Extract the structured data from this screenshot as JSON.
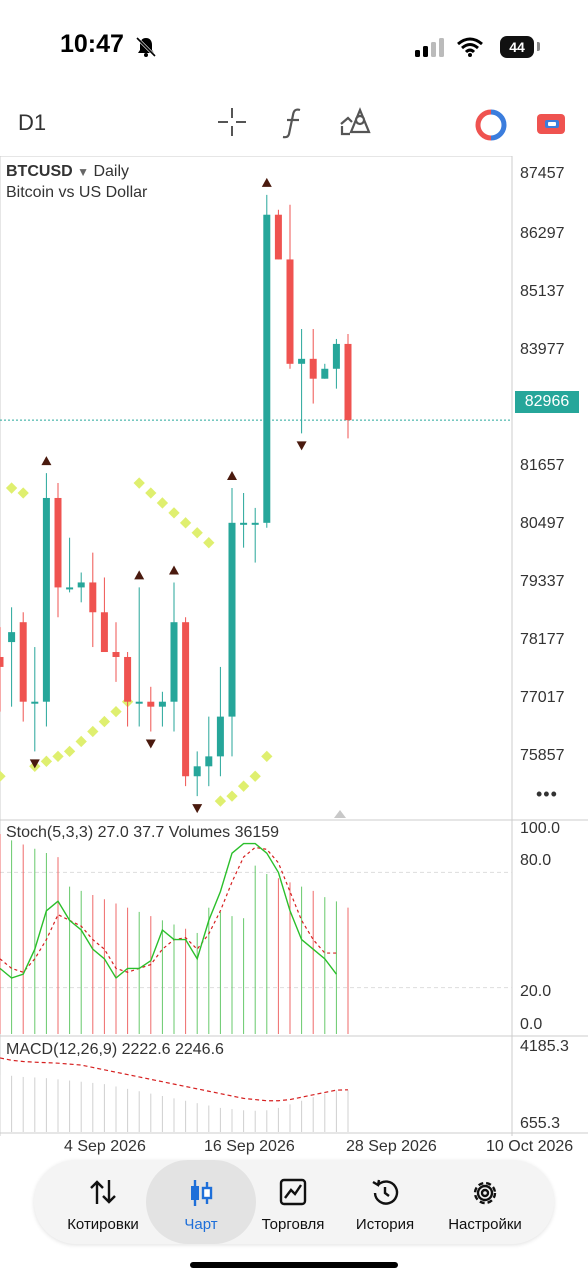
{
  "status": {
    "time": "10:47",
    "battery": "44"
  },
  "toolbar": {
    "timeframe": "D1",
    "icons": [
      "crosshair-icon",
      "function-icon",
      "objects-icon",
      "one-click-trading-icon",
      "account-icon"
    ]
  },
  "chart": {
    "symbol": "BTCUSD",
    "period": "Daily",
    "description": "Bitcoin vs US Dollar",
    "current_price": "82966",
    "price_axis": [
      "87457",
      "86297",
      "85137",
      "83977",
      "81657",
      "80497",
      "79337",
      "78177",
      "77017",
      "75857"
    ],
    "stoch_label": "Stoch(5,3,3) 27.0 37.7 Volumes 36159",
    "stoch_axis": [
      "100.0",
      "80.0",
      "20.0",
      "0.0"
    ],
    "macd_label": "MACD(12,26,9) 2222.6 2246.6",
    "macd_axis": [
      "4185.3",
      "655.3"
    ],
    "date_axis": [
      "4 Sep 2026",
      "16 Sep 2026",
      "28 Sep 2026",
      "10 Oct 2026"
    ],
    "colors": {
      "bull": "#26a69a",
      "bear": "#ef5350",
      "sar": "#dfef6f",
      "fractal": "#4a1a0e",
      "stoch_main": "#2bbf2b",
      "stoch_signal": "#d62020"
    }
  },
  "chart_data": {
    "type": "candlestick",
    "price_range": [
      75000,
      88000
    ],
    "candles": [
      {
        "o": 78200,
        "h": 78800,
        "l": 77100,
        "c": 78000
      },
      {
        "o": 78500,
        "h": 79200,
        "l": 77200,
        "c": 78700
      },
      {
        "o": 78900,
        "h": 79100,
        "l": 76900,
        "c": 77300
      },
      {
        "o": 77300,
        "h": 78400,
        "l": 76300,
        "c": 77300
      },
      {
        "o": 77300,
        "h": 81900,
        "l": 76800,
        "c": 81400
      },
      {
        "o": 81400,
        "h": 81700,
        "l": 79000,
        "c": 79600
      },
      {
        "o": 79600,
        "h": 80600,
        "l": 79500,
        "c": 79600
      },
      {
        "o": 79600,
        "h": 79900,
        "l": 79300,
        "c": 79700
      },
      {
        "o": 79700,
        "h": 80300,
        "l": 78400,
        "c": 79100
      },
      {
        "o": 79100,
        "h": 79800,
        "l": 78500,
        "c": 78300
      },
      {
        "o": 78300,
        "h": 78900,
        "l": 77700,
        "c": 78200
      },
      {
        "o": 78200,
        "h": 78300,
        "l": 76800,
        "c": 77300
      },
      {
        "o": 77300,
        "h": 79600,
        "l": 76800,
        "c": 77300
      },
      {
        "o": 77300,
        "h": 77600,
        "l": 76700,
        "c": 77200
      },
      {
        "o": 77200,
        "h": 77500,
        "l": 76800,
        "c": 77300
      },
      {
        "o": 77300,
        "h": 79700,
        "l": 76700,
        "c": 78900
      },
      {
        "o": 78900,
        "h": 79000,
        "l": 75600,
        "c": 75800
      },
      {
        "o": 75800,
        "h": 76300,
        "l": 75400,
        "c": 76000
      },
      {
        "o": 76000,
        "h": 77000,
        "l": 75600,
        "c": 76200
      },
      {
        "o": 76200,
        "h": 78000,
        "l": 75800,
        "c": 77000
      },
      {
        "o": 77000,
        "h": 81600,
        "l": 76200,
        "c": 80900
      },
      {
        "o": 80900,
        "h": 81500,
        "l": 80400,
        "c": 80900
      },
      {
        "o": 80900,
        "h": 81200,
        "l": 80100,
        "c": 80900
      },
      {
        "o": 80900,
        "h": 87500,
        "l": 80800,
        "c": 87100
      },
      {
        "o": 87100,
        "h": 87200,
        "l": 86200,
        "c": 86200
      },
      {
        "o": 86200,
        "h": 87300,
        "l": 84000,
        "c": 84100
      },
      {
        "o": 84100,
        "h": 84800,
        "l": 82700,
        "c": 84200
      },
      {
        "o": 84200,
        "h": 84800,
        "l": 83300,
        "c": 83800
      },
      {
        "o": 83800,
        "h": 84100,
        "l": 83800,
        "c": 84000
      },
      {
        "o": 84000,
        "h": 84600,
        "l": 83600,
        "c": 84500
      },
      {
        "o": 84500,
        "h": 84700,
        "l": 82600,
        "c": 82966
      }
    ],
    "sar": [
      75800,
      81600,
      81500,
      76000,
      76100,
      76200,
      76300,
      76500,
      76700,
      76900,
      77100,
      77300,
      81700,
      81500,
      81300,
      81100,
      80900,
      80700,
      80500,
      75300,
      75400,
      75600,
      75800,
      76200,
      null,
      null,
      null,
      null,
      null,
      null,
      null
    ],
    "stoch_main": [
      30,
      25,
      27,
      40,
      60,
      65,
      55,
      50,
      40,
      35,
      25,
      30,
      30,
      34,
      50,
      45,
      45,
      35,
      55,
      70,
      90,
      95,
      95,
      90,
      80,
      60,
      45,
      40,
      35,
      27
    ],
    "stoch_signal": [
      35,
      30,
      28,
      35,
      45,
      58,
      55,
      52,
      45,
      40,
      30,
      28,
      30,
      32,
      40,
      45,
      46,
      40,
      48,
      60,
      75,
      88,
      93,
      92,
      85,
      70,
      55,
      45,
      38,
      38
    ],
    "volume": [
      95,
      92,
      90,
      88,
      86,
      84,
      70,
      68,
      66,
      64,
      62,
      60,
      58,
      56,
      54,
      52,
      50,
      48,
      60,
      58,
      56,
      55,
      80,
      76,
      74,
      72,
      70,
      68,
      65,
      63,
      60
    ],
    "macd": [
      2900,
      2850,
      2800,
      2780,
      2750,
      2700,
      2650,
      2600,
      2550,
      2500,
      2400,
      2300,
      2200,
      2100,
      2000,
      1900,
      1800,
      1700,
      1600,
      1500,
      1450,
      1400,
      1380,
      1400,
      1500,
      1650,
      1800,
      1950,
      2100,
      2222.6,
      2240
    ],
    "macd_signal": [
      3600,
      3500,
      3450,
      3420,
      3400,
      3380,
      3340,
      3300,
      3200,
      3100,
      3000,
      2900,
      2800,
      2700,
      2600,
      2500,
      2400,
      2300,
      2200,
      2100,
      2000,
      1900,
      1850,
      1800,
      1800,
      1850,
      1950,
      2050,
      2150,
      2246.6,
      2260
    ]
  },
  "tabs": [
    {
      "label": "Котировки",
      "icon": "quotes-icon"
    },
    {
      "label": "Чарт",
      "icon": "chart-icon"
    },
    {
      "label": "Торговля",
      "icon": "trade-icon"
    },
    {
      "label": "История",
      "icon": "history-icon"
    },
    {
      "label": "Настройки",
      "icon": "settings-icon"
    }
  ]
}
